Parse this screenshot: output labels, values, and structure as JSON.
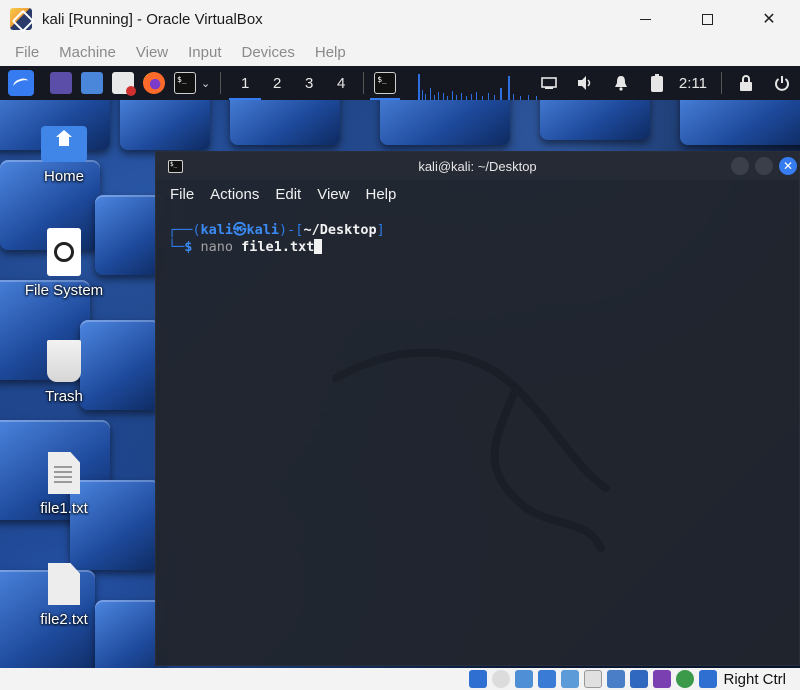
{
  "window": {
    "title": "kali [Running] - Oracle VirtualBox",
    "controls": {
      "minimize": "minimize",
      "maximize": "maximize",
      "close": "✕"
    }
  },
  "vbox_menu": [
    "File",
    "Machine",
    "View",
    "Input",
    "Devices",
    "Help"
  ],
  "panel": {
    "workspaces": [
      "1",
      "2",
      "3",
      "4"
    ],
    "active_workspace": "1",
    "clock": "2:11",
    "terminal_glyph": "$_",
    "chevron": "⌄"
  },
  "desktop": {
    "icons": [
      {
        "label": "Home",
        "icon": "home-folder-icon"
      },
      {
        "label": "File System",
        "icon": "drive-icon"
      },
      {
        "label": "Trash",
        "icon": "trash-icon"
      },
      {
        "label": "file1.txt",
        "icon": "text-file-icon"
      },
      {
        "label": "file2.txt",
        "icon": "blank-file-icon"
      }
    ]
  },
  "terminal": {
    "title": "kali@kali: ~/Desktop",
    "menu": [
      "File",
      "Actions",
      "Edit",
      "View",
      "Help"
    ],
    "prompt": {
      "corner_top": "┌──(",
      "user": "kali",
      "at": "㉿",
      "host": "kali",
      "mid": ")-[",
      "path": "~/Desktop",
      "end": "]",
      "corner_bottom": "└─",
      "dollar": "$ ",
      "command": "nano",
      "argument": " file1.txt"
    }
  },
  "status_bar": {
    "host_key": "Right Ctrl"
  },
  "colors": {
    "kali_blue": "#367bf0",
    "panel_bg": "#151820",
    "terminal_bg": "#21252e"
  }
}
